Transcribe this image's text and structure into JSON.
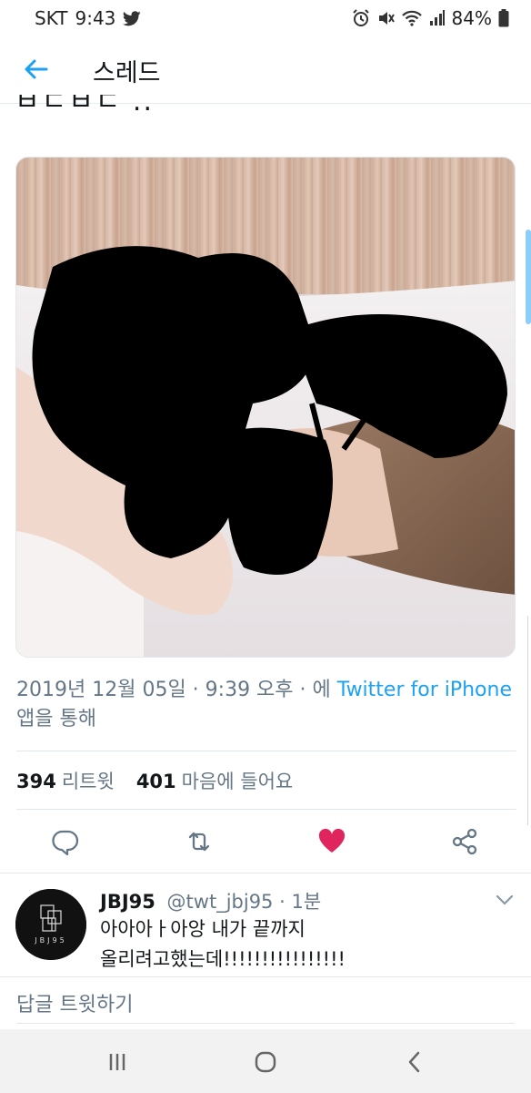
{
  "status_bar": {
    "carrier": "SKT",
    "time": "9:43",
    "battery": "84%",
    "icons": [
      "twitter-icon",
      "alarm-icon",
      "mute-icon",
      "wifi-icon",
      "signal-icon",
      "battery-icon"
    ]
  },
  "header": {
    "title": "스레드",
    "back_icon": "arrow-left-icon"
  },
  "tweet": {
    "text_cut": "ㅂㄷㅂㄷ ..",
    "date_line_prefix": "2019년 12월 05일 · 9:39 오후 · 에 ",
    "source_link": "Twitter for iPhone",
    "date_line_suffix": " 앱을 통해",
    "retweet_count": "394",
    "retweet_label": "리트윗",
    "like_count": "401",
    "like_label": "마음에 들어요",
    "accent_color": "#1da1f2",
    "like_color": "#e0245e"
  },
  "reply": {
    "name": "JBJ95",
    "handle": "@twt_jbj95",
    "time": "1분",
    "text_line1": "아아아ㅏ아앙 내가 끝까지",
    "text_line2": "올리려고했는데!!!!!!!!!!!!!!!!",
    "avatar_text": "JBJ95"
  },
  "reply_bar": {
    "placeholder": "답글 트윗하기"
  },
  "navbar": {
    "icons": [
      "recent-apps-icon",
      "home-icon",
      "back-icon"
    ]
  }
}
